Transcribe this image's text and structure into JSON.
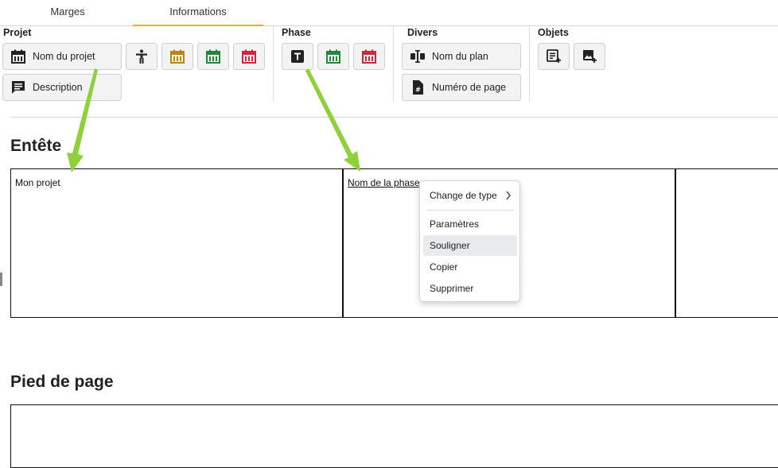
{
  "tabs": [
    {
      "label": "Marges",
      "active": false
    },
    {
      "label": "Informations",
      "active": true
    }
  ],
  "accent_color": "#f2b200",
  "ribbon": {
    "projet": {
      "title": "Projet",
      "nom_du_projet": "Nom du projet",
      "description": "Description"
    },
    "phase": {
      "title": "Phase"
    },
    "divers": {
      "title": "Divers",
      "nom_du_plan": "Nom du plan",
      "numero_de_page": "Numéro de page"
    },
    "objets": {
      "title": "Objets"
    }
  },
  "icon_colors": {
    "gold": "#b8860b",
    "green": "#1e8a3a",
    "red": "#d0263a",
    "dark": "#222222"
  },
  "entete": {
    "title": "Entête",
    "cell1": "Mon projet",
    "cell2": "Nom de la phase"
  },
  "pied_de_page": {
    "title": "Pied de page"
  },
  "context_menu": {
    "items": [
      "Change de type",
      "Paramètres",
      "Souligner",
      "Copier",
      "Supprimer"
    ],
    "highlighted": "Souligner"
  },
  "annotation_color": "#8fd13a"
}
